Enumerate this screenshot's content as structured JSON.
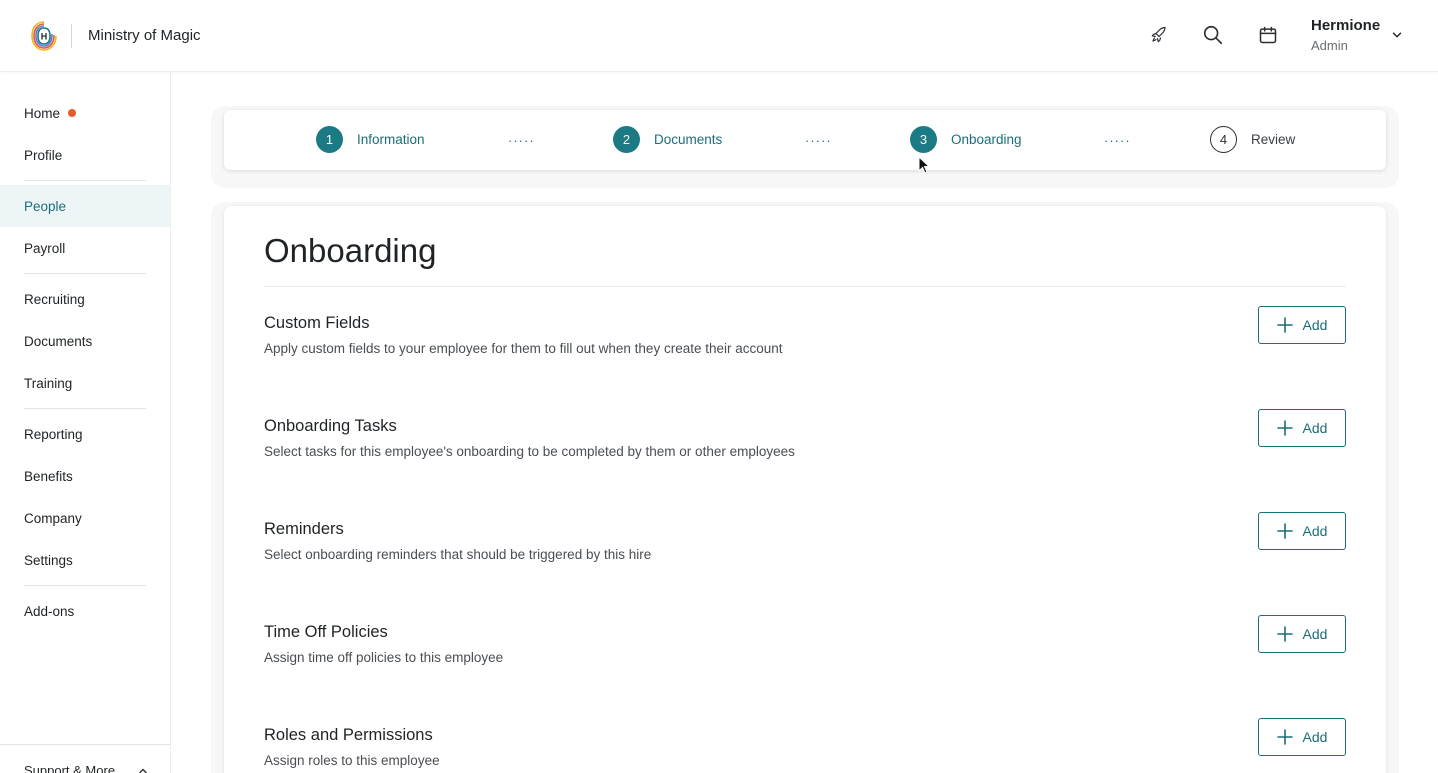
{
  "header": {
    "company": "Ministry of Magic",
    "user_name": "Hermione",
    "user_role": "Admin",
    "icons": [
      "rocket-icon",
      "search-icon",
      "calendar-icon",
      "chevron-down-icon"
    ]
  },
  "sidebar": {
    "items": [
      {
        "label": "Home",
        "badge": "notification-dot"
      },
      {
        "label": "Profile"
      },
      {
        "label": "People",
        "active": true
      },
      {
        "label": "Payroll"
      },
      {
        "label": "Recruiting"
      },
      {
        "label": "Documents"
      },
      {
        "label": "Training"
      },
      {
        "label": "Reporting"
      },
      {
        "label": "Benefits"
      },
      {
        "label": "Company"
      },
      {
        "label": "Settings"
      },
      {
        "label": "Add-ons"
      }
    ],
    "support_label": "Support & More"
  },
  "stepper": {
    "steps": [
      {
        "num": "1",
        "label": "Information",
        "state": "complete"
      },
      {
        "num": "2",
        "label": "Documents",
        "state": "complete"
      },
      {
        "num": "3",
        "label": "Onboarding",
        "state": "current"
      },
      {
        "num": "4",
        "label": "Review",
        "state": "pending"
      }
    ],
    "separator": "·····"
  },
  "card": {
    "title": "Onboarding",
    "add_label": "Add",
    "sections": [
      {
        "title": "Custom Fields",
        "desc": "Apply custom fields to your employee for them to fill out when they create their account"
      },
      {
        "title": "Onboarding Tasks",
        "desc": "Select tasks for this employee's onboarding to be completed by them or other employees"
      },
      {
        "title": "Reminders",
        "desc": "Select onboarding reminders that should be triggered by this hire"
      },
      {
        "title": "Time Off Policies",
        "desc": "Assign time off policies to this employee"
      },
      {
        "title": "Roles and Permissions",
        "desc": "Assign roles to this employee"
      }
    ]
  },
  "colors": {
    "accent": "#1c7a84",
    "accent_text": "#1c6e78",
    "notification": "#e85a2c",
    "active_bg": "#eef5f6"
  }
}
